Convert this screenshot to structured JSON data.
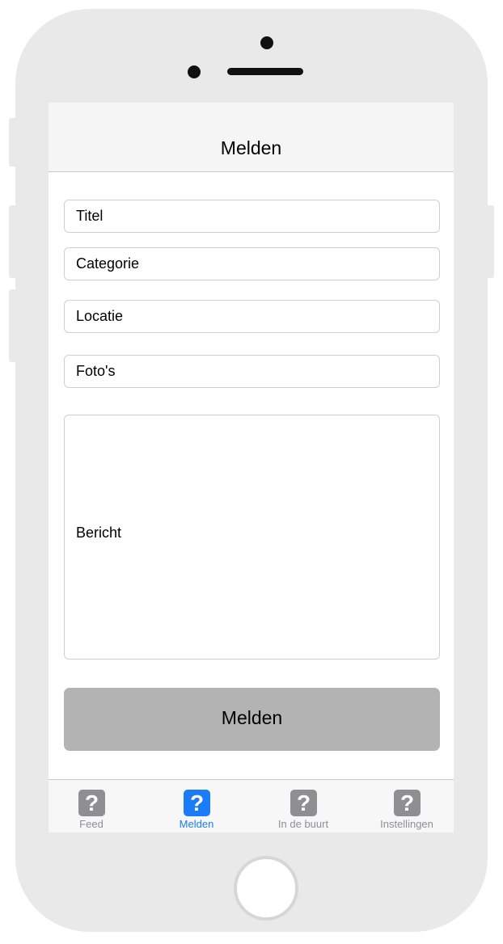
{
  "header": {
    "title": "Melden"
  },
  "form": {
    "title_field": "Titel",
    "category_field": "Categorie",
    "location_field": "Locatie",
    "photos_field": "Foto's",
    "message_field": "Bericht",
    "submit_label": "Melden"
  },
  "tabbar": {
    "items": [
      {
        "label": "Feed",
        "icon": "question-mark-icon",
        "active": false
      },
      {
        "label": "Melden",
        "icon": "question-mark-icon",
        "active": true
      },
      {
        "label": "In de buurt",
        "icon": "question-mark-icon",
        "active": false
      },
      {
        "label": "Instellingen",
        "icon": "question-mark-icon",
        "active": false
      }
    ],
    "icon_glyph": "?"
  },
  "colors": {
    "accent": "#1a7cf6",
    "inactive": "#8e8e93",
    "button": "#b3b3b3",
    "device": "#e9e9e9"
  }
}
